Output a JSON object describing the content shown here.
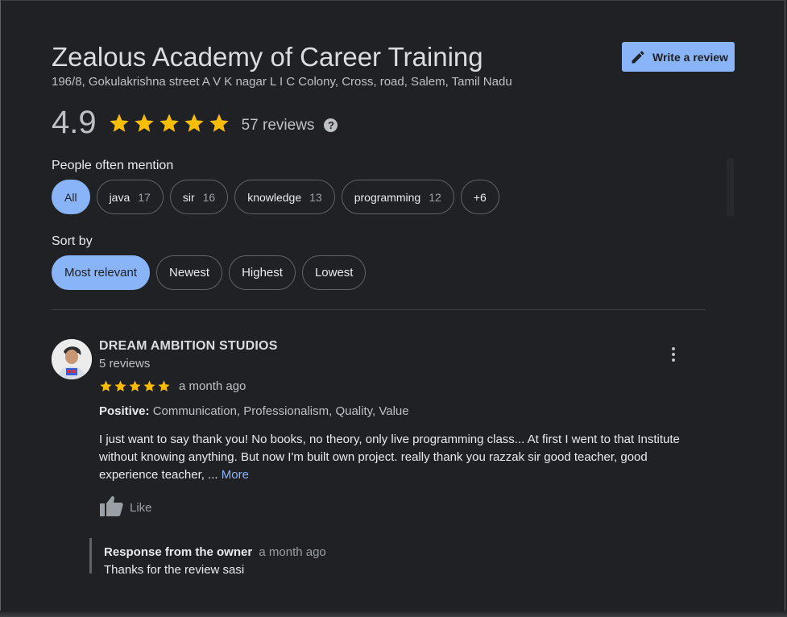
{
  "business": {
    "name": "Zealous Academy of Career Training",
    "address": "196/8, Gokulakrishna street A V K nagar L I C Colony, Cross, road, Salem, Tamil Nadu",
    "rating": "4.9",
    "stars": 5,
    "review_count": "57 reviews",
    "help_glyph": "?"
  },
  "actions": {
    "write_review": "Write a review"
  },
  "mentions": {
    "label": "People often mention",
    "chips": [
      {
        "label": "All",
        "count": ""
      },
      {
        "label": "java",
        "count": "17"
      },
      {
        "label": "sir",
        "count": "16"
      },
      {
        "label": "knowledge",
        "count": "13"
      },
      {
        "label": "programming",
        "count": "12"
      },
      {
        "label": "+6",
        "count": ""
      }
    ]
  },
  "sort": {
    "label": "Sort by",
    "options": [
      "Most relevant",
      "Newest",
      "Highest",
      "Lowest"
    ],
    "selected": "Most relevant"
  },
  "review": {
    "author": "DREAM AMBITION STUDIOS",
    "author_reviews": "5 reviews",
    "stars": 5,
    "date": "a month ago",
    "positive_label": "Positive:",
    "positive_values": "Communication, Professionalism, Quality, Value",
    "text": "I just want to say thank you! No books, no theory, only live programming class... At first I went to that Institute without knowing anything. But now I'm built own project. really thank you razzak sir good teacher, good experience teacher, ...",
    "more": "More",
    "like": "Like",
    "response": {
      "title": "Response from the owner",
      "date": "a month ago",
      "text": "Thanks for the review sasi"
    }
  },
  "colors": {
    "background": "#202124",
    "accent": "#8ab4f8",
    "star": "#fbbc04",
    "text_primary": "#e8eaed",
    "text_secondary": "#bdc1c6"
  },
  "icons": {
    "write": "pencil-icon",
    "star": "star-icon",
    "help": "help-icon",
    "menu": "more-vert-icon",
    "like": "thumb-up-icon"
  }
}
